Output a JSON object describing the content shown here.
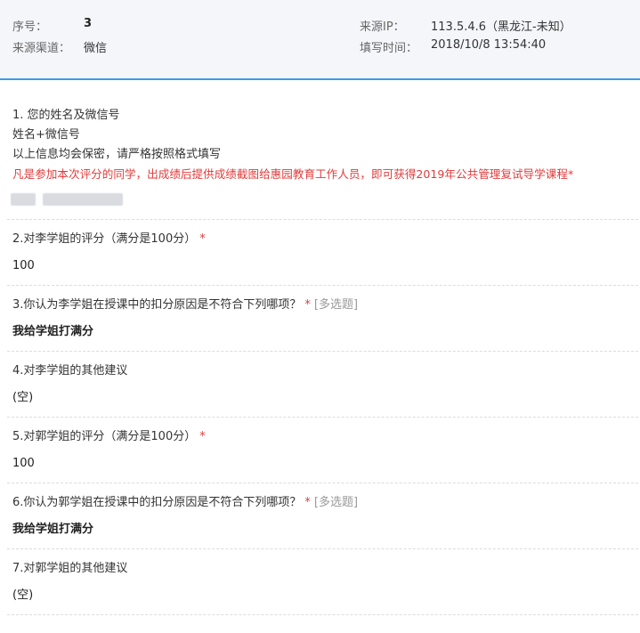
{
  "meta": {
    "serial_label": "序号：",
    "serial_value": "3",
    "channel_label": "来源渠道：",
    "channel_value": "微信",
    "ip_label": "来源IP：",
    "ip_value": "113.5.4.6（黑龙江-未知）",
    "time_label": "填写时间：",
    "time_value": "2018/10/8 13:54:40"
  },
  "questions": [
    {
      "title": "1. 您的姓名及微信号",
      "desc_1": "姓名+微信号",
      "desc_2": "以上信息均会保密，请严格按照格式填写",
      "desc_red": "凡是参加本次评分的同学，出成绩后提供成绩截图给惠园教育工作人员，即可获得2019年公共管理复试导学课程",
      "required_mark": "*"
    },
    {
      "title": "2.对李学姐的评分（满分是100分）",
      "required_mark": "*",
      "answer": "100"
    },
    {
      "title": "3.你认为李学姐在授课中的扣分原因是不符合下列哪项？",
      "required_mark": "*",
      "tag": "[多选题]",
      "answer": "我给学姐打满分"
    },
    {
      "title": "4.对李学姐的其他建议",
      "answer": "(空)"
    },
    {
      "title": "5.对郭学姐的评分（满分是100分）",
      "required_mark": "*",
      "answer": "100"
    },
    {
      "title": "6.你认为郭学姐在授课中的扣分原因是不符合下列哪项？",
      "required_mark": "*",
      "tag": "[多选题]",
      "answer": "我给学姐打满分"
    },
    {
      "title": "7.对郭学姐的其他建议",
      "answer": "(空)"
    }
  ],
  "colors": {
    "accent_blue": "#3b9ae8",
    "required_red": "#e23b3b",
    "header_bg": "#f5f6fa"
  }
}
